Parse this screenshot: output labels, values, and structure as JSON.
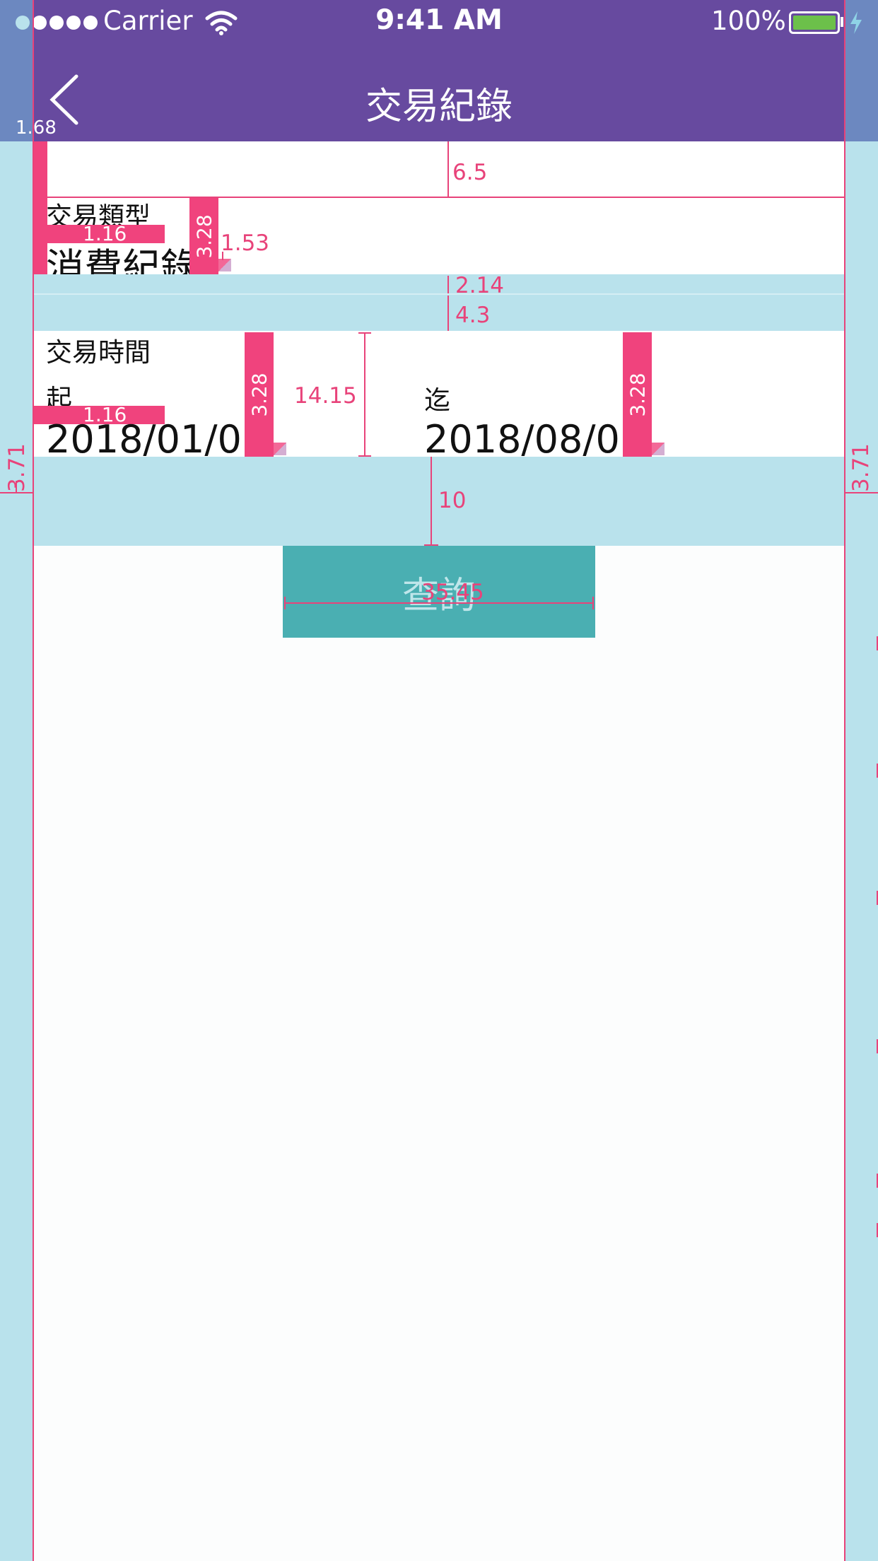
{
  "status_bar": {
    "carrier": "Carrier",
    "time": "9:41 AM",
    "battery": "100%",
    "signal_icon": "signal-dots-icon",
    "wifi_icon": "wifi-icon",
    "battery_icon": "battery-icon",
    "charging_icon": "lightning-icon"
  },
  "nav": {
    "title": "交易紀錄",
    "back_icon": "chevron-left-icon"
  },
  "form": {
    "type_label": "交易類型",
    "type_value": "消費紀錄",
    "time_label": "交易時間",
    "from_label": "起",
    "from_value": "2018/01/01",
    "to_label": "迄",
    "to_value": "2018/08/01"
  },
  "query_button": {
    "label": "查詢"
  },
  "annotations": {
    "back_offset": "1.68",
    "top_gap": "6.5",
    "label_gap_1": "1.16",
    "col_width_1": "3.28",
    "gap_1_53": "1.53",
    "gap_2_14": "2.14",
    "gap_4_3": "4.3",
    "label_gap_2": "1.16",
    "col_width_2": "3.28",
    "row_height": "14.15",
    "col_width_3": "3.28",
    "side_left": "3.71",
    "side_right": "3.71",
    "gap_10": "10",
    "button_width": "35.45"
  },
  "colors": {
    "nav_bg": "#674a9f",
    "accent_pink": "#f0437d",
    "light_blue": "#b9e2ec",
    "button_teal": "#4aafb2"
  }
}
